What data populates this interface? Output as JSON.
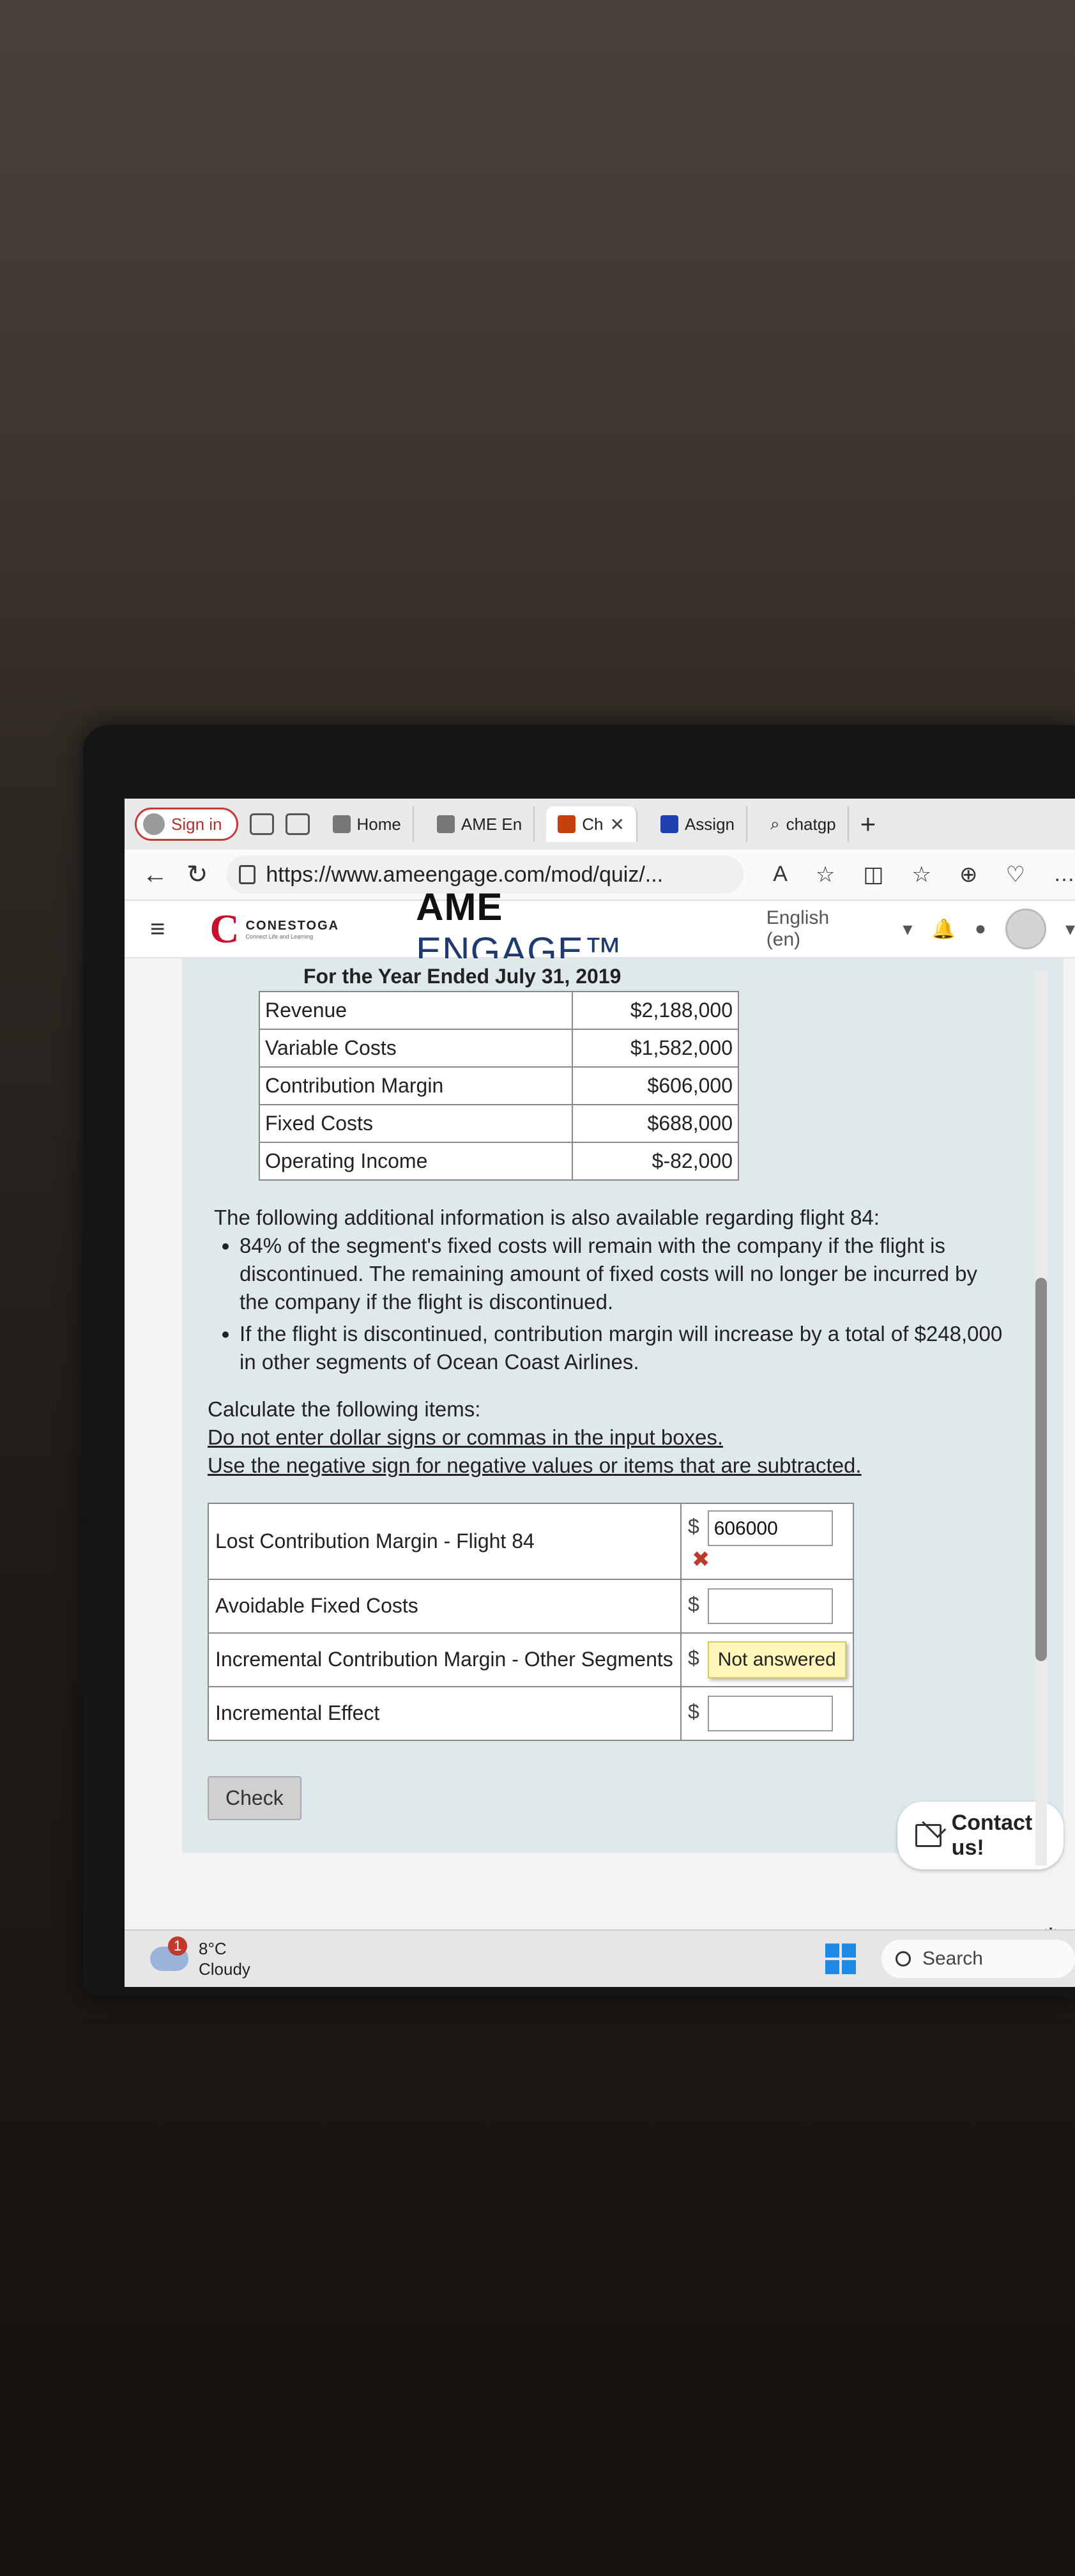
{
  "browser": {
    "sign_in": "Sign in",
    "tabs": [
      {
        "label": "Home",
        "active": false
      },
      {
        "label": "AME En",
        "active": false
      },
      {
        "label": "Ch",
        "active": true
      },
      {
        "label": "Assign",
        "active": false
      },
      {
        "label": "chatgp",
        "active": false
      }
    ],
    "new_tab": "+",
    "url": "https://www.ameengage.com/mod/quiz/...",
    "read_aloud": "A̩"
  },
  "site": {
    "institution": "CONESTOGA",
    "institution_tag": "Connect Life and Learning",
    "brand_bold": "AME",
    "brand_light": "ENGAGE™",
    "language": "English (en)"
  },
  "statement": {
    "period": "For the Year Ended July 31, 2019",
    "rows": [
      {
        "label": "Revenue",
        "value": "$2,188,000"
      },
      {
        "label": "Variable Costs",
        "value": "$1,582,000"
      },
      {
        "label": "Contribution Margin",
        "value": "$606,000"
      },
      {
        "label": "Fixed Costs",
        "value": "$688,000"
      },
      {
        "label": "Operating Income",
        "value": "$-82,000"
      }
    ]
  },
  "info": {
    "intro": "The following additional information is also available regarding flight 84:",
    "bullets": [
      "84% of the segment's fixed costs will remain with the company if the flight is discontinued. The remaining amount of fixed costs will no longer be incurred by the company if the flight is discontinued.",
      "If the flight is discontinued, contribution margin will increase by a total of $248,000 in other segments of Ocean Coast Airlines."
    ]
  },
  "instructions": {
    "heading": "Calculate the following items:",
    "line1": "Do not enter dollar signs or commas in the input boxes.",
    "line2": "Use the negative sign for negative values or items that are subtracted."
  },
  "answers": {
    "currency": "$",
    "rows": [
      {
        "label": "Lost Contribution Margin - Flight 84",
        "value": "606000",
        "status": "incorrect"
      },
      {
        "label": "Avoidable Fixed Costs",
        "value": ""
      },
      {
        "label": "Incremental Contribution Margin - Other Segments",
        "value": "",
        "tooltip": "Not answered"
      },
      {
        "label": "Incremental Effect",
        "value": ""
      }
    ]
  },
  "actions": {
    "check": "Check",
    "contact": "Contact us!"
  },
  "taskbar": {
    "weather_badge": "1",
    "temperature": "8°C",
    "condition": "Cloudy",
    "search": "Search"
  }
}
